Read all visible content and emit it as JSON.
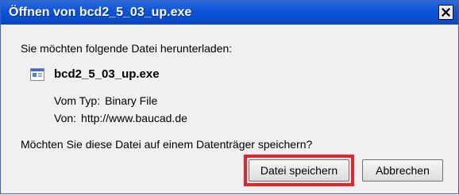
{
  "dialog": {
    "title": "Öffnen von bcd2_5_03_up.exe",
    "message": "Sie möchten folgende Datei herunterladen:",
    "file": {
      "name": "bcd2_5_03_up.exe",
      "icon": "exe-file-icon",
      "type_label": "Vom Typ:",
      "type_value": "Binary File",
      "from_label": "Von:",
      "from_value": "http://www.baucad.de"
    },
    "question": "Möchten Sie diese Datei auf einem Datenträger speichern?",
    "buttons": {
      "save": "Datei speichern",
      "cancel": "Abbrechen"
    },
    "close_icon": "close-icon",
    "highlight_color": "#e5232a",
    "titlebar_color": "#0b53d8"
  }
}
